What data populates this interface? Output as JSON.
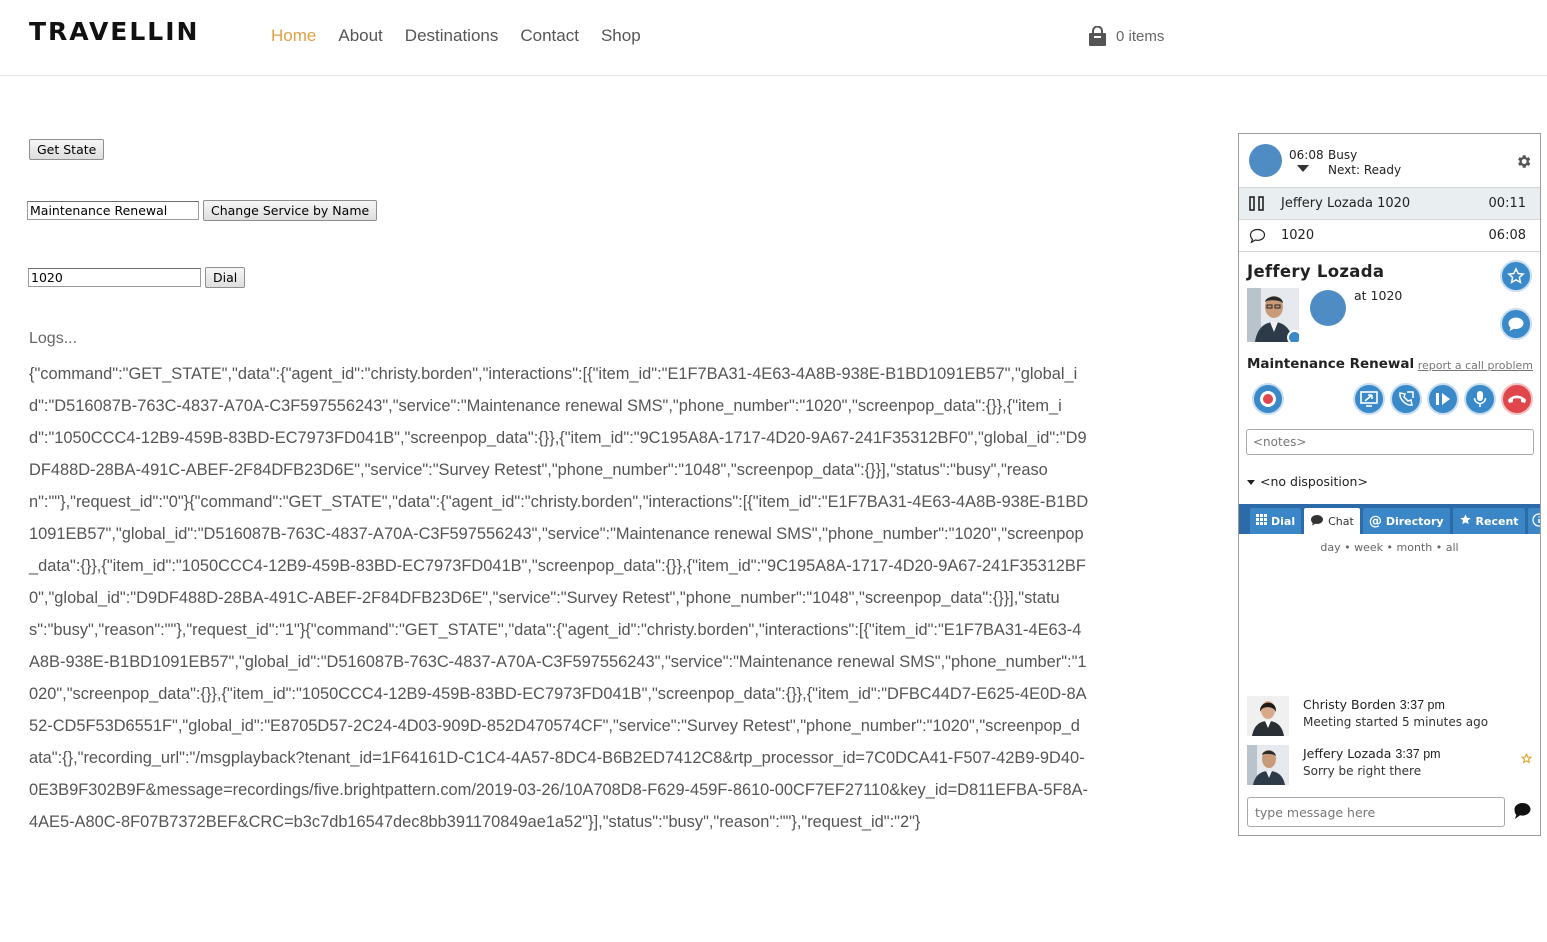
{
  "header": {
    "logo": "TRAVELLIN",
    "nav": [
      "Home",
      "About",
      "Destinations",
      "Contact",
      "Shop"
    ],
    "active_nav": "Home",
    "cart_label": "0 items"
  },
  "controls": {
    "get_state_label": "Get State",
    "service_value": "Maintenance Renewal",
    "change_service_label": "Change Service by Name",
    "dial_value": "1020",
    "dial_label": "Dial"
  },
  "logs": {
    "title": "Logs...",
    "text": "{\"command\":\"GET_STATE\",\"data\":{\"agent_id\":\"christy.borden\",\"interactions\":[{\"item_id\":\"E1F7BA31-4E63-4A8B-938E-B1BD1091EB57\",\"global_id\":\"D516087B-763C-4837-A70A-C3F597556243\",\"service\":\"Maintenance renewal SMS\",\"phone_number\":\"1020\",\"screenpop_data\":{}},{\"item_id\":\"1050CCC4-12B9-459B-83BD-EC7973FD041B\",\"screenpop_data\":{}},{\"item_id\":\"9C195A8A-1717-4D20-9A67-241F35312BF0\",\"global_id\":\"D9DF488D-28BA-491C-ABEF-2F84DFB23D6E\",\"service\":\"Survey Retest\",\"phone_number\":\"1048\",\"screenpop_data\":{}}],\"status\":\"busy\",\"reason\":\"\"},\"request_id\":\"0\"}{\"command\":\"GET_STATE\",\"data\":{\"agent_id\":\"christy.borden\",\"interactions\":[{\"item_id\":\"E1F7BA31-4E63-4A8B-938E-B1BD1091EB57\",\"global_id\":\"D516087B-763C-4837-A70A-C3F597556243\",\"service\":\"Maintenance renewal SMS\",\"phone_number\":\"1020\",\"screenpop_data\":{}},{\"item_id\":\"1050CCC4-12B9-459B-83BD-EC7973FD041B\",\"screenpop_data\":{}},{\"item_id\":\"9C195A8A-1717-4D20-9A67-241F35312BF0\",\"global_id\":\"D9DF488D-28BA-491C-ABEF-2F84DFB23D6E\",\"service\":\"Survey Retest\",\"phone_number\":\"1048\",\"screenpop_data\":{}}],\"status\":\"busy\",\"reason\":\"\"},\"request_id\":\"1\"}{\"command\":\"GET_STATE\",\"data\":{\"agent_id\":\"christy.borden\",\"interactions\":[{\"item_id\":\"E1F7BA31-4E63-4A8B-938E-B1BD1091EB57\",\"global_id\":\"D516087B-763C-4837-A70A-C3F597556243\",\"service\":\"Maintenance renewal SMS\",\"phone_number\":\"1020\",\"screenpop_data\":{}},{\"item_id\":\"1050CCC4-12B9-459B-83BD-EC7973FD041B\",\"screenpop_data\":{}},{\"item_id\":\"DFBC44D7-E625-4E0D-8A52-CD5F53D6551F\",\"global_id\":\"E8705D57-2C24-4D03-909D-852D470574CF\",\"service\":\"Survey Retest\",\"phone_number\":\"1020\",\"screenpop_data\":{},\"recording_url\":\"/msgplayback?tenant_id=1F64161D-C1C4-4A57-8DC4-B6B2ED7412C8&rtp_processor_id=7C0DCA41-F507-42B9-9D40-0E3B9F302B9F&message=recordings/five.brightpattern.com/2019-03-26/10A708D8-F629-459F-8610-00CF7EF27110&key_id=D811EFBA-5F8A-4AE5-A80C-8F07B7372BEF&CRC=b3c7db16547dec8bb391170849ae1a52\"}],\"status\":\"busy\",\"reason\":\"\"},\"request_id\":\"2\"}"
  },
  "agent": {
    "status_time": "06:08",
    "status": "Busy",
    "next_status": "Next: Ready",
    "interactions": [
      {
        "name": "Jeffery Lozada 1020",
        "time": "00:11",
        "icon": "pause-icon"
      },
      {
        "name": "1020",
        "time": "06:08",
        "icon": "chat-bubble-icon"
      }
    ],
    "contact_name": "Jeffery Lozada",
    "at_text": "at 1020",
    "service": "Maintenance Renewal",
    "report_link": "report a call problem",
    "notes_placeholder": "<notes>",
    "disposition": "<no disposition>",
    "tabs": [
      "Dial",
      "Chat",
      "Directory",
      "Recent"
    ],
    "active_tab": "Chat",
    "periods": [
      "day",
      "week",
      "month",
      "all"
    ],
    "messages": [
      {
        "name": "Christy Borden",
        "time": "3:37 pm",
        "text": "Meeting started 5 minutes ago"
      },
      {
        "name": "Jeffery Lozada",
        "time": "3:37 pm",
        "text": "Sorry be right there"
      }
    ],
    "message_placeholder": "type message here"
  },
  "colors": {
    "nav_active": "#e0a045",
    "agent_blue": "#3a89c9",
    "hangup_red": "#e0474c",
    "tab_bar": "#2c6aa8"
  }
}
